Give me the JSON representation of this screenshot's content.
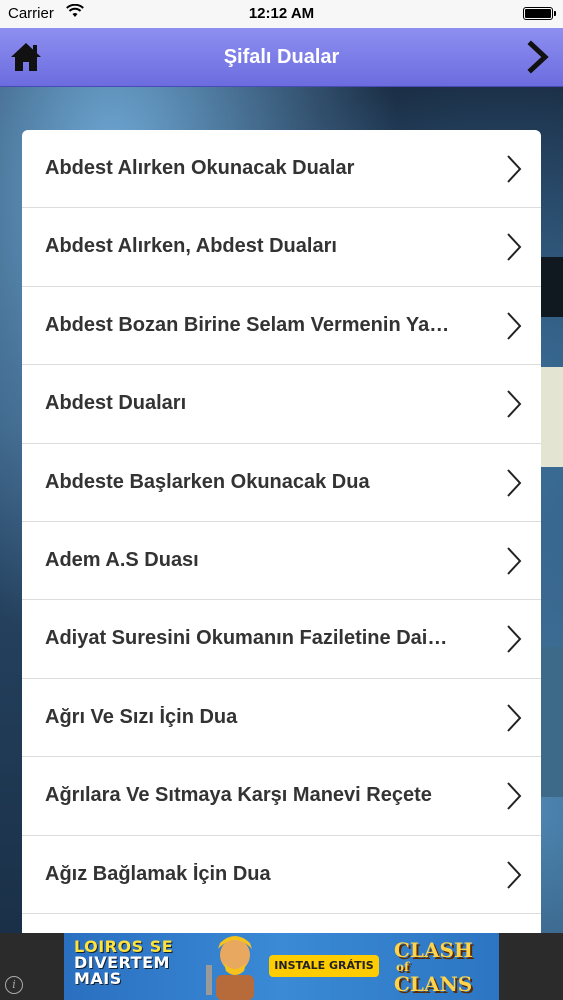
{
  "status_bar": {
    "carrier": "Carrier",
    "time": "12:12 AM"
  },
  "nav": {
    "title": "Şifalı Dualar",
    "left_icon": "home-icon",
    "right_icon": "chevron-right-icon"
  },
  "list": {
    "items": [
      {
        "label": "Abdest Alırken Okunacak Dualar"
      },
      {
        "label": "Abdest Alırken, Abdest Duaları"
      },
      {
        "label": "Abdest Bozan Birine Selam Vermenin Ya…"
      },
      {
        "label": "Abdest Duaları"
      },
      {
        "label": "Abdeste Başlarken Okunacak Dua"
      },
      {
        "label": "Adem A.S Duası"
      },
      {
        "label": "Adiyat Suresini Okumanın Faziletine Dai…"
      },
      {
        "label": "Ağrı Ve Sızı İçin Dua"
      },
      {
        "label": "Ağrılara Ve Sıtmaya Karşı Manevi Reçete"
      },
      {
        "label": "Ağız Bağlamak İçin Dua"
      },
      {
        "label": ""
      }
    ]
  },
  "ad": {
    "line1": "LOIROS SE",
    "line2": "DIVERTEM",
    "line3": "MAIS",
    "cta": "INSTALE GRÁTIS",
    "logo_top": "CLASH",
    "logo_small": "of",
    "logo_bottom": "CLANS",
    "info": "i"
  },
  "colors": {
    "nav_top": "#8e8ff0",
    "nav_bottom": "#6c6ce0",
    "row_text": "#333333"
  }
}
